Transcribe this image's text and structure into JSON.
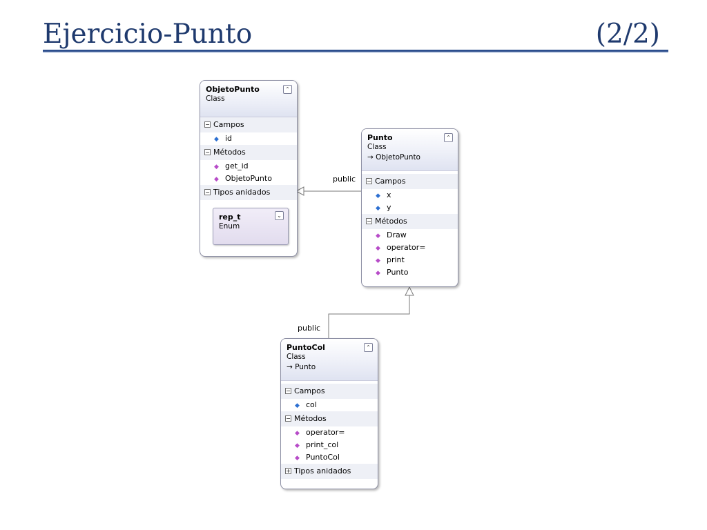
{
  "slide": {
    "title": "Ejercicio-Punto",
    "page": "(2/2)"
  },
  "classes": {
    "objetopunto": {
      "name": "ObjetoPunto",
      "kind": "Class",
      "campos_label": "Campos",
      "fields": [
        "id"
      ],
      "metodos_label": "Métodos",
      "methods": [
        "get_id",
        "ObjetoPunto"
      ],
      "tipos_label": "Tipos anidados",
      "nested": {
        "name": "rep_t",
        "kind": "Enum"
      }
    },
    "punto": {
      "name": "Punto",
      "kind": "Class",
      "base": "ObjetoPunto",
      "campos_label": "Campos",
      "fields": [
        "x",
        "y"
      ],
      "metodos_label": "Métodos",
      "methods": [
        "Draw",
        "operator=",
        "print",
        "Punto"
      ]
    },
    "puntocol": {
      "name": "PuntoCol",
      "kind": "Class",
      "base": "Punto",
      "campos_label": "Campos",
      "fields": [
        "col"
      ],
      "metodos_label": "Métodos",
      "methods": [
        "operator=",
        "print_col",
        "PuntoCol"
      ],
      "tipos_label": "Tipos anidados"
    }
  },
  "connectors": {
    "punto_to_objetopunto": "public",
    "puntocol_to_punto": "public"
  }
}
